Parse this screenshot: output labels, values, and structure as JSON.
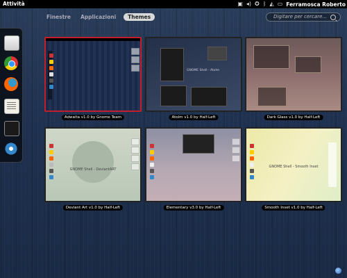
{
  "panel": {
    "activities": "Attività",
    "user_name": "Ferramosca Roberto",
    "icons": [
      "chat-icon",
      "volume-icon",
      "accessibility-icon",
      "bluetooth-icon",
      "network-icon",
      "battery-icon"
    ]
  },
  "tabs": [
    {
      "label": "Finestre",
      "active": false
    },
    {
      "label": "Applicazioni",
      "active": false
    },
    {
      "label": "Themes",
      "active": true
    }
  ],
  "search": {
    "placeholder": "Digitare per cercare..."
  },
  "dash": {
    "items": [
      "files-icon",
      "chrome-icon",
      "firefox-icon",
      "text-editor-icon",
      "terminal-icon",
      "gnome-tweak-icon"
    ]
  },
  "themes": [
    {
      "caption": "Adwaita v1.0 by Gnome Team",
      "selected": true
    },
    {
      "caption": "Atolm v1.0 by Half-Left",
      "selected": false
    },
    {
      "caption": "Dark Glass v1.0 by Half-Left",
      "selected": false
    },
    {
      "caption": "Deviant Art v1.0 by Half-Left",
      "selected": false
    },
    {
      "caption": "Elementary v3.0 by Half-Left",
      "selected": false
    },
    {
      "caption": "Smooth Inset v1.0 by Half-Left",
      "selected": false
    }
  ],
  "thumb_labels": {
    "atolm": "GNOME Shell - Atolm",
    "deviant": "GNOME Shell - DeviantART",
    "smooth": "GNOME Shell - Smooth Inset"
  },
  "colors": {
    "selected_border": "#c41e2a",
    "panel": "#000000"
  }
}
